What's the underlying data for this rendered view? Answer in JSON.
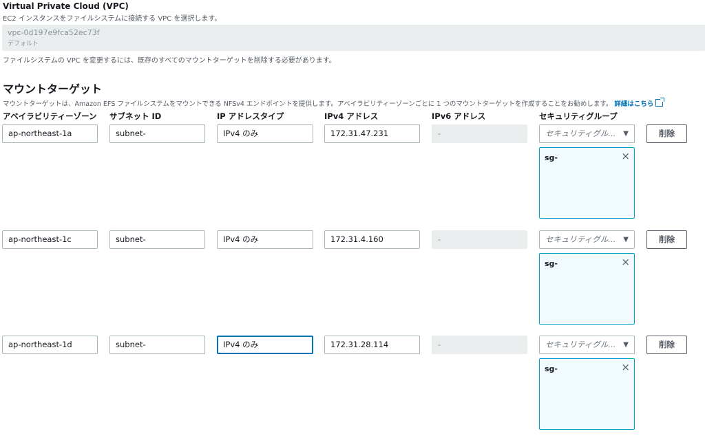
{
  "vpc": {
    "title": "Virtual Private Cloud (VPC)",
    "description": "EC2 インスタンスをファイルシステムに接続する VPC を選択します。",
    "selected_id": "vpc-0d197e9fca52ec73f",
    "selected_sub": "デフォルト",
    "help": "ファイルシステムの VPC を変更するには、既存のすべてのマウントターゲットを削除する必要があります。"
  },
  "mount_targets": {
    "heading": "マウントターゲット",
    "description": "マウントターゲットは、Amazon EFS ファイルシステムをマウントできる NFSv4 エンドポイントを提供します。アベイラビリティーゾーンごとに 1 つのマウントターゲットを作成することをお勧めします。",
    "learn_more": "詳細はこちら",
    "columns": {
      "az": "アベイラビリティーゾーン",
      "subnet": "サブネット ID",
      "ip_type": "IP アドレスタイプ",
      "ipv4": "IPv4 アドレス",
      "ipv6": "IPv6 アドレス",
      "sg": "セキュリティグループ"
    },
    "sg_placeholder": "セキュリティグル...",
    "delete_label": "削除",
    "remove_icon": "×",
    "rows": [
      {
        "az": "ap-northeast-1a",
        "subnet": "subnet-",
        "ip_type": "IPv4 のみ",
        "ipv4": "172.31.47.231",
        "ipv6": "-",
        "sg_token": "sg-"
      },
      {
        "az": "ap-northeast-1c",
        "subnet": "subnet-",
        "ip_type": "IPv4 のみ",
        "ipv4": "172.31.4.160",
        "ipv6": "-",
        "sg_token": "sg-"
      },
      {
        "az": "ap-northeast-1d",
        "subnet": "subnet-",
        "ip_type": "IPv4 のみ",
        "ipv4": "172.31.28.114",
        "ipv6": "-",
        "sg_token": "sg-"
      }
    ]
  },
  "colors": {
    "accent": "#0073bb",
    "token_border": "#00a1c9",
    "disabled": "#eaeded"
  },
  "icons": {
    "external": "external-link-icon",
    "caret": "caret-down-icon",
    "close": "close-icon"
  }
}
